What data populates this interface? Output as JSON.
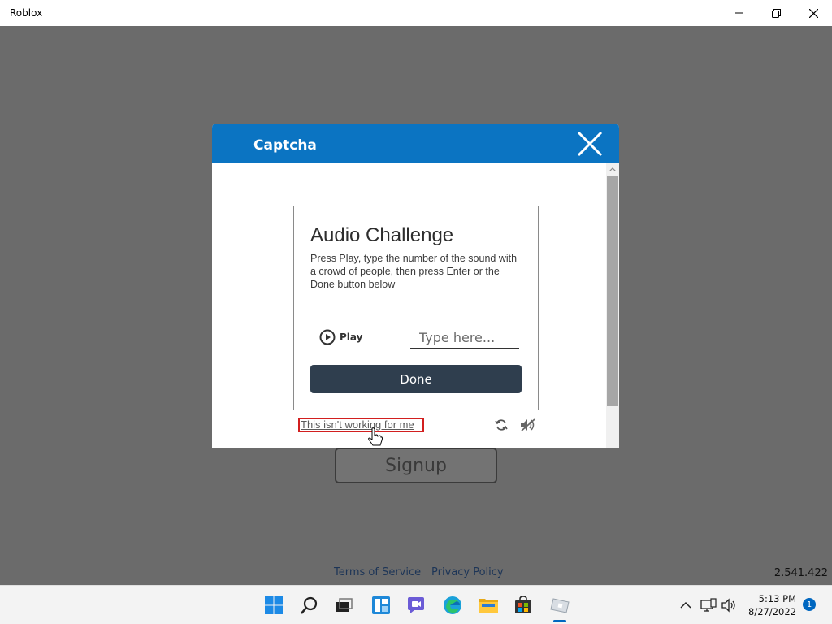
{
  "window": {
    "title": "Roblox"
  },
  "captcha": {
    "header_title": "Captcha",
    "challenge_title": "Audio Challenge",
    "instructions": "Press Play, type the number of the sound with a crowd of people, then press Enter or the Done button below",
    "play_label": "Play",
    "answer_placeholder": "Type here...",
    "done_label": "Done",
    "not_working_link": "This isn't working for me"
  },
  "page": {
    "signup_label": "Signup",
    "terms_link": "Terms of Service",
    "privacy_link": "Privacy Policy",
    "version": "2.541.422"
  },
  "taskbar": {
    "time": "5:13 PM",
    "date": "8/27/2022",
    "notification_count": "1",
    "apps": [
      "start",
      "search",
      "task-view",
      "widgets",
      "teams-chat",
      "edge",
      "file-explorer",
      "store",
      "roblox"
    ]
  },
  "colors": {
    "accent": "#0b74c2",
    "done_button": "#2f3e4e",
    "highlight_border": "#d21f1f",
    "overlay": "#6b6b6b"
  }
}
